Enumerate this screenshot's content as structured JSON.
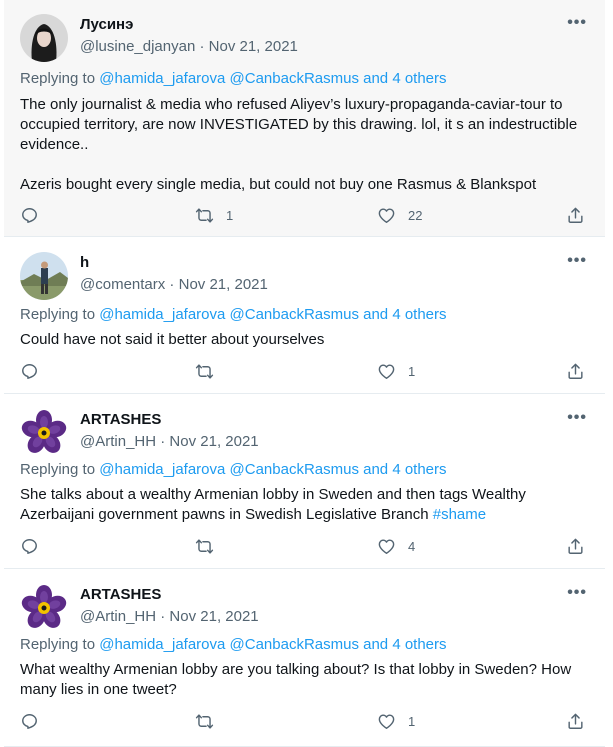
{
  "tweets": [
    {
      "name": "Лусинэ",
      "handle": "@lusine_djanyan",
      "date": "Nov 21, 2021",
      "replying_label": "Replying to",
      "replying_links": "@hamida_jafarova @CanbackRasmus and 4 others",
      "text_line1": "The only journalist & media who refused Aliyev’s luxury-propaganda-caviar-tour to",
      "text_line2": "occupied territory, are now INVESTIGATED by this drawing. lol, it s an indestructible",
      "text_line3": "evidence..",
      "text_line4": "Azeris bought every single media, but could not buy one Rasmus & Blankspot",
      "retweets": "1",
      "likes": "22"
    },
    {
      "name": "h",
      "handle": "@comentarx",
      "date": "Nov 21, 2021",
      "replying_label": "Replying to",
      "replying_links": "@hamida_jafarova @CanbackRasmus and 4 others",
      "text_line1": "Could have not said it better about yourselves",
      "retweets": "",
      "likes": "1"
    },
    {
      "name": "ARTASHES",
      "handle": "@Artin_HH",
      "date": "Nov 21, 2021",
      "replying_label": "Replying to",
      "replying_links": "@hamida_jafarova @CanbackRasmus and 4 others",
      "text_line1": "She talks about a wealthy Armenian lobby in Sweden and then tags Wealthy",
      "text_line2": "Azerbaijani government pawns in Swedish Legislative Branch",
      "hashtag": "#shame",
      "retweets": "",
      "likes": "4"
    },
    {
      "name": "ARTASHES",
      "handle": "@Artin_HH",
      "date": "Nov 21, 2021",
      "replying_label": "Replying to",
      "replying_links": "@hamida_jafarova @CanbackRasmus and 4 others",
      "text_line1": "What wealthy Armenian lobby are you talking about? Is that lobby in Sweden? How",
      "text_line2": "many lies in one tweet?",
      "retweets": "",
      "likes": "1"
    }
  ],
  "more_glyph": "•••",
  "separator": " · ",
  "colors": {
    "link": "#1d9bf0",
    "muted": "#536471",
    "text": "#0f1419",
    "highlight_bg": "#f7f7f7"
  },
  "icons": [
    "reply-icon",
    "retweet-icon",
    "like-icon",
    "share-icon",
    "more-icon",
    "forget-me-not-avatar"
  ]
}
